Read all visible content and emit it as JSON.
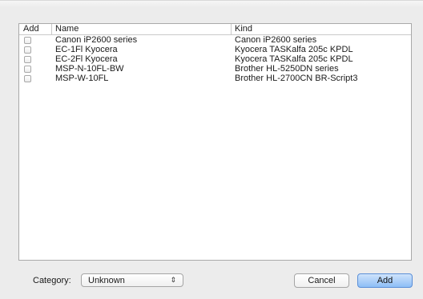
{
  "table": {
    "headers": {
      "add": "Add",
      "name": "Name",
      "kind": "Kind"
    },
    "rows": [
      {
        "checked": false,
        "name": "Canon iP2600 series",
        "kind": "Canon iP2600 series"
      },
      {
        "checked": false,
        "name": "EC-1Fl Kyocera",
        "kind": "Kyocera TASKalfa 205c KPDL"
      },
      {
        "checked": false,
        "name": "EC-2Fl Kyocera",
        "kind": "Kyocera TASKalfa 205c KPDL"
      },
      {
        "checked": false,
        "name": "MSP-N-10FL-BW",
        "kind": "Brother HL-5250DN series"
      },
      {
        "checked": false,
        "name": "MSP-W-10FL",
        "kind": "Brother HL-2700CN BR-Script3"
      }
    ]
  },
  "footer": {
    "category_label": "Category:",
    "category_value": "Unknown",
    "cancel_label": "Cancel",
    "add_label": "Add"
  },
  "colors": {
    "default_button": "#8dbef6",
    "window_background": "#ececec"
  }
}
